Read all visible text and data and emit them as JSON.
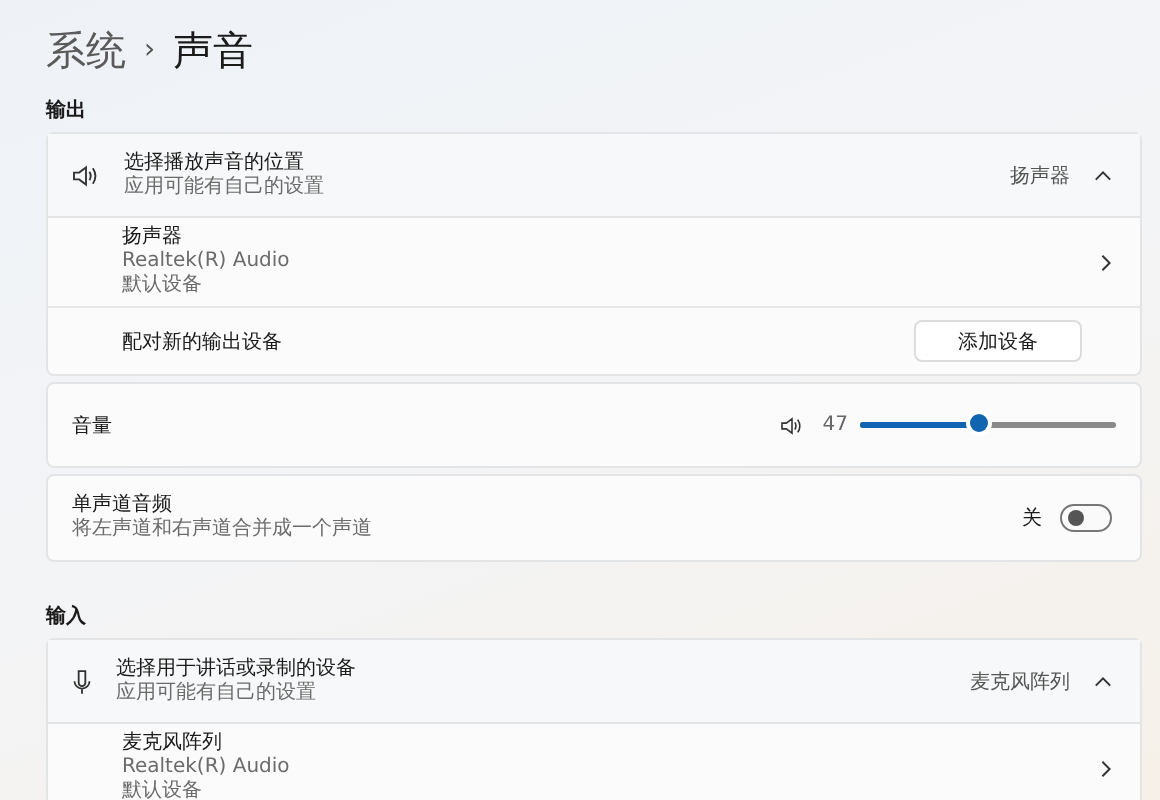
{
  "breadcrumb": {
    "parent": "系统",
    "separator": "›",
    "current": "声音"
  },
  "output": {
    "heading": "输出",
    "picker": {
      "title": "选择播放声音的位置",
      "subtitle": "应用可能有自己的设置",
      "value": "扬声器",
      "expanded": true
    },
    "devices": [
      {
        "name": "扬声器",
        "driver": "Realtek(R) Audio",
        "status": "默认设备"
      }
    ],
    "pair": {
      "label": "配对新的输出设备",
      "button": "添加设备"
    }
  },
  "volume": {
    "label": "音量",
    "reading": "47",
    "level": 0.47
  },
  "mono": {
    "title": "单声道音频",
    "subtitle": "将左声道和右声道合并成一个声道",
    "state_label": "关",
    "on": false
  },
  "input": {
    "heading": "输入",
    "picker": {
      "title": "选择用于讲话或录制的设备",
      "subtitle": "应用可能有自己的设置",
      "value": "麦克风阵列",
      "expanded": true
    },
    "devices": [
      {
        "name": "麦克风阵列",
        "driver": "Realtek(R) Audio",
        "status": "默认设备"
      }
    ]
  }
}
